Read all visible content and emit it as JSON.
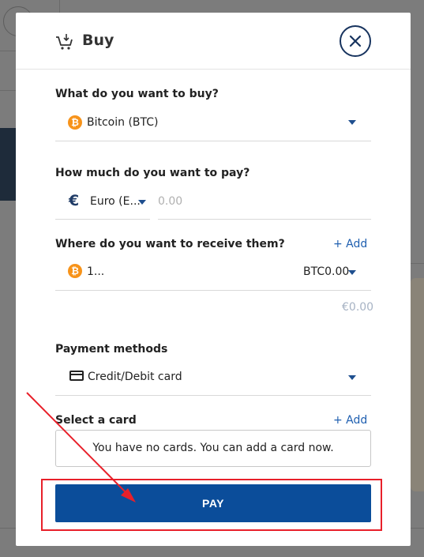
{
  "modal": {
    "title": "Buy",
    "close_icon": "close-icon",
    "cart_icon": "cart-icon"
  },
  "asset": {
    "label": "What do you want to buy?",
    "selected": "Bitcoin (BTC)",
    "icon": "bitcoin-icon",
    "icon_glyph": "₿"
  },
  "payment_amount": {
    "label": "How much do you want to pay?",
    "currency_selected": "Euro (E...",
    "currency_symbol": "€",
    "amount_placeholder": "0.00"
  },
  "receive": {
    "label": "Where do you want to receive them?",
    "add_label": "+ Add",
    "wallet_name": "1...",
    "wallet_balance": "BTC0.00",
    "fiat_equivalent": "€0.00"
  },
  "payment_methods": {
    "label": "Payment methods",
    "selected": "Credit/Debit card",
    "icon": "credit-card-icon"
  },
  "card_select": {
    "label": "Select a card",
    "add_label": "+ Add",
    "empty_message": "You have no cards. You can add a card now."
  },
  "pay_button": {
    "label": "PAY"
  },
  "colors": {
    "primary": "#0b4d9a",
    "link": "#1f5fb0",
    "bitcoin": "#f7931a",
    "annotation": "#e8202a"
  }
}
